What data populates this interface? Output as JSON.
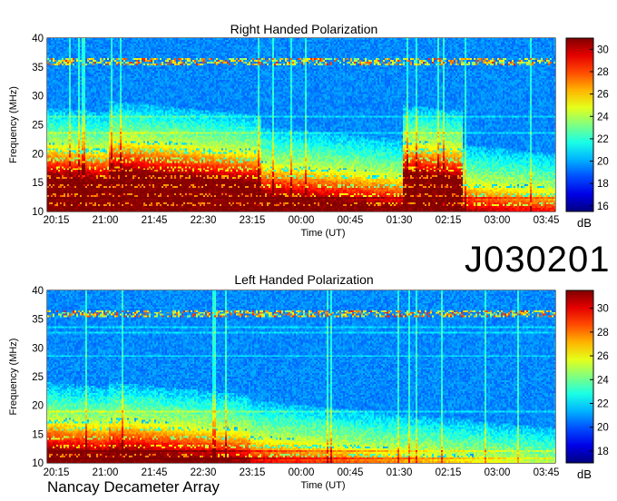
{
  "event_id": "J030201",
  "instrument": "Nancay Decameter Array",
  "chart_data": [
    {
      "type": "heatmap",
      "title": "Right Handed Polarization",
      "xlabel": "Time (UT)",
      "ylabel": "Frequency (MHz)",
      "x_ticks": [
        "20:15",
        "21:00",
        "21:45",
        "22:30",
        "23:15",
        "00:00",
        "00:45",
        "01:30",
        "02:15",
        "03:00",
        "03:45"
      ],
      "y_ticks": [
        10,
        15,
        20,
        25,
        30,
        35,
        40
      ],
      "ylim": [
        10,
        40
      ],
      "colorbar": {
        "unit": "dB",
        "ticks": [
          16,
          18,
          20,
          22,
          24,
          26,
          28,
          30
        ],
        "range": [
          15.5,
          31
        ]
      },
      "vertical_lines": [
        {
          "time": "21:05",
          "color": "#b8860b"
        },
        {
          "time": "22:10",
          "color": "#8b1a1a"
        },
        {
          "time": "23:10",
          "color": "#8b1a1a"
        },
        {
          "time": "00:20",
          "color": "#00bcd4"
        },
        {
          "time": "01:15",
          "color": "#4f7fd9"
        },
        {
          "time": "02:00",
          "color": "#d2691e"
        },
        {
          "time": "02:55",
          "color": "#8b1a1a"
        }
      ],
      "horizontal_lines": [
        {
          "freq": 32,
          "color": "#e8e070"
        }
      ]
    },
    {
      "type": "heatmap",
      "title": "Left Handed Polarization",
      "xlabel": "Time (UT)",
      "ylabel": "Frequency (MHz)",
      "x_ticks": [
        "20:15",
        "21:00",
        "21:45",
        "22:30",
        "23:15",
        "00:00",
        "00:45",
        "01:30",
        "02:15",
        "03:00",
        "03:45"
      ],
      "y_ticks": [
        10,
        15,
        20,
        25,
        30,
        35,
        40
      ],
      "ylim": [
        10,
        40
      ],
      "colorbar": {
        "unit": "dB",
        "ticks": [
          18,
          20,
          22,
          24,
          26,
          28,
          30
        ],
        "range": [
          17,
          31.5
        ]
      },
      "vertical_lines": [
        {
          "time": "21:05",
          "color": "#b8860b"
        },
        {
          "time": "22:10",
          "color": "#8b1a1a"
        },
        {
          "time": "23:10",
          "color": "#8b1a1a"
        },
        {
          "time": "00:20",
          "color": "#00bcd4"
        },
        {
          "time": "01:15",
          "color": "#4f7fd9"
        },
        {
          "time": "02:00",
          "color": "#d2691e"
        },
        {
          "time": "02:55",
          "color": "#8b1a1a"
        }
      ],
      "horizontal_lines": [
        {
          "freq": 32,
          "color": "#e8e070"
        }
      ]
    }
  ]
}
